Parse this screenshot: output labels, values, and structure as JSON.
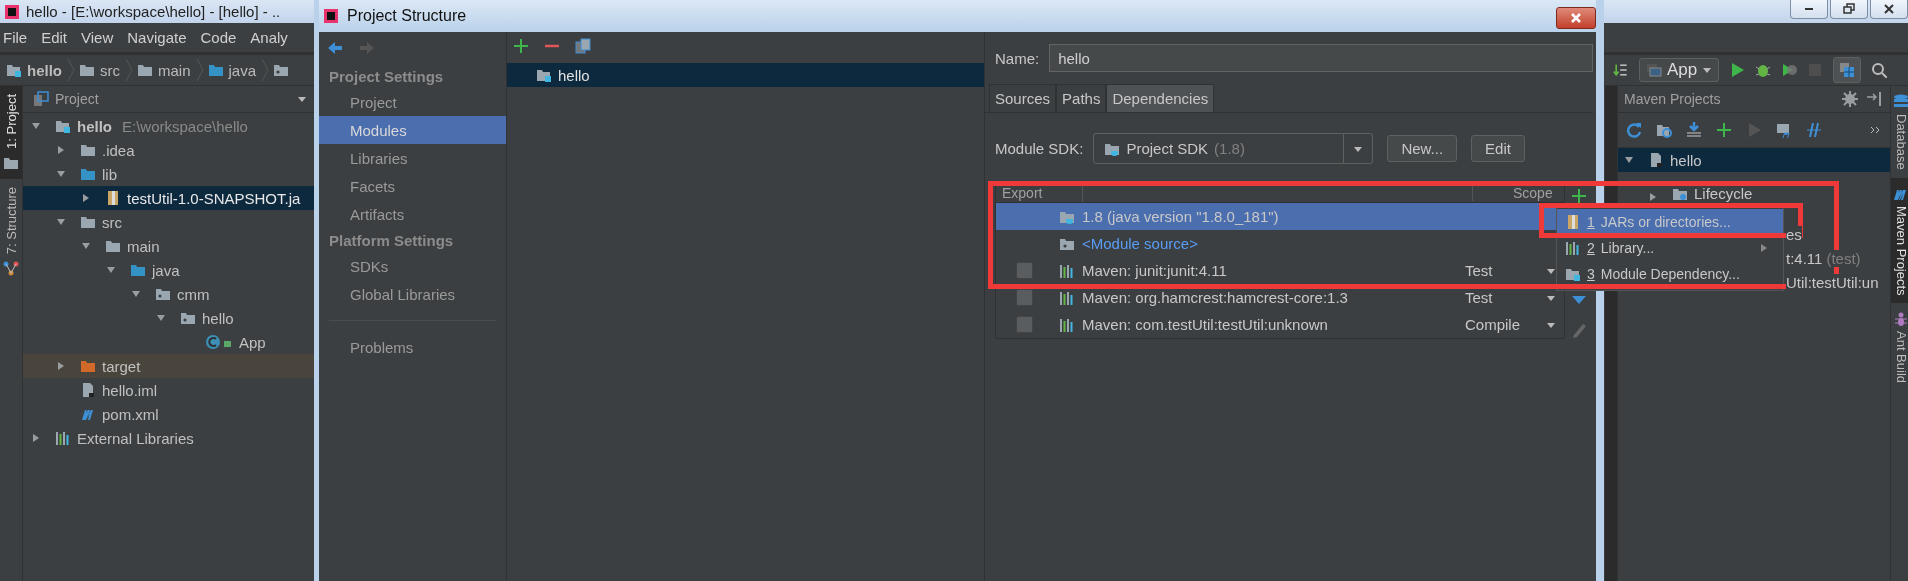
{
  "ide": {
    "title": "hello - [E:\\workspace\\hello] - [hello] - ..",
    "menu": [
      "File",
      "Edit",
      "View",
      "Navigate",
      "Code",
      "Analy"
    ],
    "breadcrumb": [
      "hello",
      "src",
      "main",
      "java"
    ],
    "left_stripe": [
      {
        "label": "1: Project",
        "selected": true
      },
      {
        "label": "7: Structure",
        "selected": false
      }
    ],
    "project_panel": {
      "title": "Project",
      "tree": [
        {
          "name": "hello",
          "detail": "E:\\workspace\\hello",
          "kind": "module",
          "expanded": true,
          "selected": false,
          "children": [
            {
              "name": ".idea",
              "kind": "folder",
              "expanded": false,
              "selected": false
            },
            {
              "name": "lib",
              "kind": "source-folder",
              "expanded": true,
              "selected": false,
              "children": [
                {
                  "name": "testUtil-1.0-SNAPSHOT.ja",
                  "kind": "jar",
                  "expanded": false,
                  "selected": true
                }
              ]
            },
            {
              "name": "src",
              "kind": "folder",
              "expanded": true,
              "selected": false,
              "children": [
                {
                  "name": "main",
                  "kind": "folder",
                  "expanded": true,
                  "selected": false,
                  "children": [
                    {
                      "name": "java",
                      "kind": "source-folder",
                      "expanded": true,
                      "selected": false,
                      "children": [
                        {
                          "name": "cmm",
                          "kind": "package",
                          "expanded": true,
                          "selected": false,
                          "children": [
                            {
                              "name": "hello",
                              "kind": "package",
                              "expanded": true,
                              "selected": false,
                              "children": [
                                {
                                  "name": "App",
                                  "kind": "class",
                                  "selected": false
                                }
                              ]
                            }
                          ]
                        }
                      ]
                    }
                  ]
                }
              ]
            },
            {
              "name": "target",
              "kind": "excluded-folder",
              "expanded": false,
              "selected": false
            },
            {
              "name": "hello.iml",
              "kind": "iml",
              "selected": false
            },
            {
              "name": "pom.xml",
              "kind": "maven",
              "selected": false
            }
          ]
        },
        {
          "name": "External Libraries",
          "kind": "libraries",
          "expanded": false,
          "selected": false
        }
      ]
    },
    "run_config": "App",
    "maven": {
      "title": "Maven Projects",
      "tree": [
        {
          "label": "hello",
          "expanded": true,
          "selected": true,
          "children": [
            {
              "label": "Lifecycle",
              "expanded": false,
              "selected": false
            }
          ]
        }
      ],
      "covered_rows": [
        {
          "text": "es"
        },
        {
          "text": "t:4.11",
          "note": "(test)"
        },
        {
          "text": "Util:testUtil:un"
        }
      ]
    },
    "right_stripe": [
      {
        "label": "Database",
        "selected": false
      },
      {
        "label": "Maven Projects",
        "selected": true
      },
      {
        "label": "Ant Build",
        "selected": false
      }
    ]
  },
  "dialog": {
    "title": "Project Structure",
    "nav": [
      {
        "heading": "Project Settings",
        "items": [
          {
            "label": "Project",
            "selected": false
          },
          {
            "label": "Modules",
            "selected": true
          },
          {
            "label": "Libraries",
            "selected": false
          },
          {
            "label": "Facets",
            "selected": false
          },
          {
            "label": "Artifacts",
            "selected": false
          }
        ]
      },
      {
        "heading": "Platform Settings",
        "items": [
          {
            "label": "SDKs",
            "selected": false
          },
          {
            "label": "Global Libraries",
            "selected": false
          }
        ]
      }
    ],
    "nav_footer": [
      {
        "label": "Problems",
        "selected": false
      }
    ],
    "modules": [
      {
        "label": "hello",
        "selected": true
      }
    ],
    "name_label": "Name:",
    "name_value": "hello",
    "tabs": [
      {
        "label": "Sources",
        "selected": false
      },
      {
        "label": "Paths",
        "selected": false
      },
      {
        "label": "Dependencies",
        "selected": true
      }
    ],
    "sdk_label": "Module SDK:",
    "sdk_value": "Project SDK",
    "sdk_version": "(1.8)",
    "buttons": [
      "New...",
      "Edit"
    ],
    "columns": [
      "Export",
      "Scope"
    ],
    "dependencies": [
      {
        "kind": "sdk",
        "label": "1.8 (java version \"1.8.0_181\")",
        "selected": true
      },
      {
        "kind": "source",
        "label": "<Module source>",
        "selected": false
      },
      {
        "kind": "library",
        "label": "Maven: junit:junit:4.11",
        "scope": "Test",
        "exported": false,
        "selected": false
      },
      {
        "kind": "library",
        "label": "Maven: org.hamcrest:hamcrest-core:1.3",
        "scope": "Test",
        "exported": false,
        "selected": false
      },
      {
        "kind": "library",
        "label": "Maven: com.testUtil:testUtil:unknown",
        "scope": "Compile",
        "exported": false,
        "selected": false
      }
    ]
  },
  "popup_menu": [
    {
      "key": "1",
      "label": "JARs or directories...",
      "kind": "jar",
      "selected": true,
      "submenu": false
    },
    {
      "key": "2",
      "label": "Library...",
      "kind": "library",
      "selected": false,
      "submenu": true
    },
    {
      "key": "3",
      "label": "Module Dependency...",
      "kind": "module",
      "selected": false,
      "submenu": false
    }
  ]
}
